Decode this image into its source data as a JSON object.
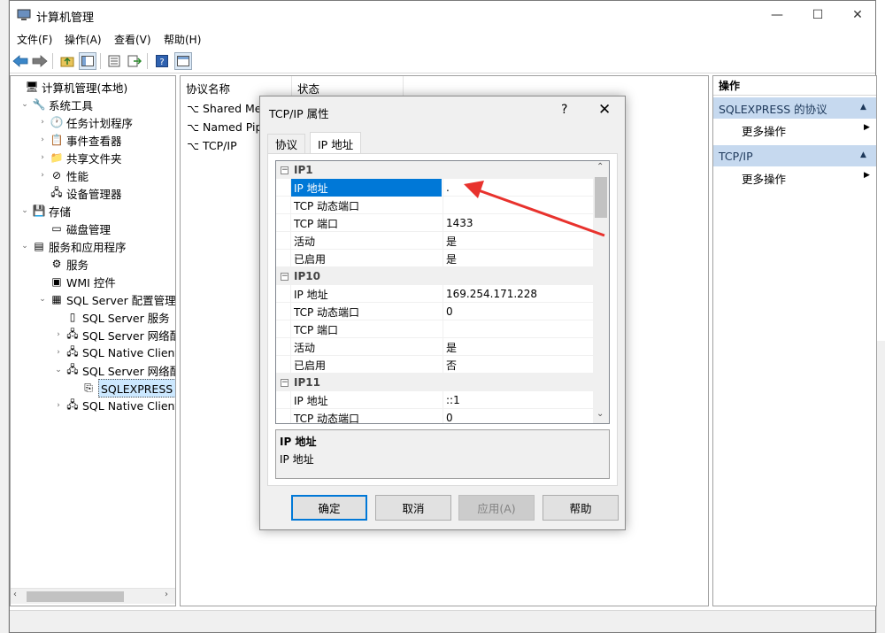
{
  "window": {
    "title": "计算机管理",
    "minimize": "—",
    "maximize": "☐",
    "close": "✕"
  },
  "menu": [
    "文件(F)",
    "操作(A)",
    "查看(V)",
    "帮助(H)"
  ],
  "toolbar": {
    "back_icon": "back-arrow-icon",
    "forward_icon": "forward-arrow-icon"
  },
  "tree": [
    {
      "label": "计算机管理(本地)",
      "level": 0,
      "expander": "",
      "icon": "🖥"
    },
    {
      "label": "系统工具",
      "level": 1,
      "expander": "⌄",
      "icon": "🔧"
    },
    {
      "label": "任务计划程序",
      "level": 2,
      "expander": "›",
      "icon": "🕐"
    },
    {
      "label": "事件查看器",
      "level": 2,
      "expander": "›",
      "icon": "📋"
    },
    {
      "label": "共享文件夹",
      "level": 2,
      "expander": "›",
      "icon": "📁"
    },
    {
      "label": "性能",
      "level": 2,
      "expander": "›",
      "icon": "⊘"
    },
    {
      "label": "设备管理器",
      "level": 2,
      "expander": "",
      "icon": "🖧"
    },
    {
      "label": "存储",
      "level": 1,
      "expander": "⌄",
      "icon": "💾"
    },
    {
      "label": "磁盘管理",
      "level": 2,
      "expander": "",
      "icon": "▭"
    },
    {
      "label": "服务和应用程序",
      "level": 1,
      "expander": "⌄",
      "icon": "▤"
    },
    {
      "label": "服务",
      "level": 2,
      "expander": "",
      "icon": "⚙"
    },
    {
      "label": "WMI 控件",
      "level": 2,
      "expander": "",
      "icon": "▣"
    },
    {
      "label": "SQL Server 配置管理器",
      "level": 2,
      "expander": "⌄",
      "icon": "▦"
    },
    {
      "label": "SQL Server 服务",
      "level": 3,
      "expander": "",
      "icon": "▯"
    },
    {
      "label": "SQL Server 网络配",
      "level": 3,
      "expander": "›",
      "icon": "🖧"
    },
    {
      "label": "SQL Native Client",
      "level": 3,
      "expander": "›",
      "icon": "🖧"
    },
    {
      "label": "SQL Server 网络配",
      "level": 3,
      "expander": "⌄",
      "icon": "🖧"
    },
    {
      "label": "SQLEXPRESS 的",
      "level": 4,
      "expander": "",
      "icon": "⎘",
      "selected": true
    },
    {
      "label": "SQL Native Client",
      "level": 3,
      "expander": "›",
      "icon": "🖧"
    }
  ],
  "list": {
    "columns": [
      "协议名称",
      "状态"
    ],
    "rows": [
      "Shared Mem",
      "Named Pipe",
      "TCP/IP"
    ]
  },
  "actions": {
    "header": "操作",
    "sections": [
      {
        "title": "SQLEXPRESS 的协议",
        "item": "更多操作"
      },
      {
        "title": "TCP/IP",
        "item": "更多操作"
      }
    ]
  },
  "dialog": {
    "title": "TCP/IP 属性",
    "help": "?",
    "close": "✕",
    "tabs": [
      "协议",
      "IP 地址"
    ],
    "groups": [
      {
        "name": "IP1",
        "rows": [
          {
            "k": "IP 地址",
            "v": ".",
            "selected": true
          },
          {
            "k": "TCP 动态端口",
            "v": ""
          },
          {
            "k": "TCP 端口",
            "v": "1433"
          },
          {
            "k": "活动",
            "v": "是"
          },
          {
            "k": "已启用",
            "v": "是"
          }
        ]
      },
      {
        "name": "IP10",
        "rows": [
          {
            "k": "IP 地址",
            "v": "169.254.171.228"
          },
          {
            "k": "TCP 动态端口",
            "v": "0"
          },
          {
            "k": "TCP 端口",
            "v": ""
          },
          {
            "k": "活动",
            "v": "是"
          },
          {
            "k": "已启用",
            "v": "否"
          }
        ]
      },
      {
        "name": "IP11",
        "rows": [
          {
            "k": "IP 地址",
            "v": "::1"
          },
          {
            "k": "TCP 动态端口",
            "v": "0"
          }
        ]
      }
    ],
    "description_title": "IP 地址",
    "description_text": "IP 地址",
    "buttons": {
      "ok": "确定",
      "cancel": "取消",
      "apply": "应用(A)",
      "help": "帮助"
    }
  },
  "colors": {
    "accent": "#0078d7",
    "annotation_arrow": "#e8322d"
  }
}
